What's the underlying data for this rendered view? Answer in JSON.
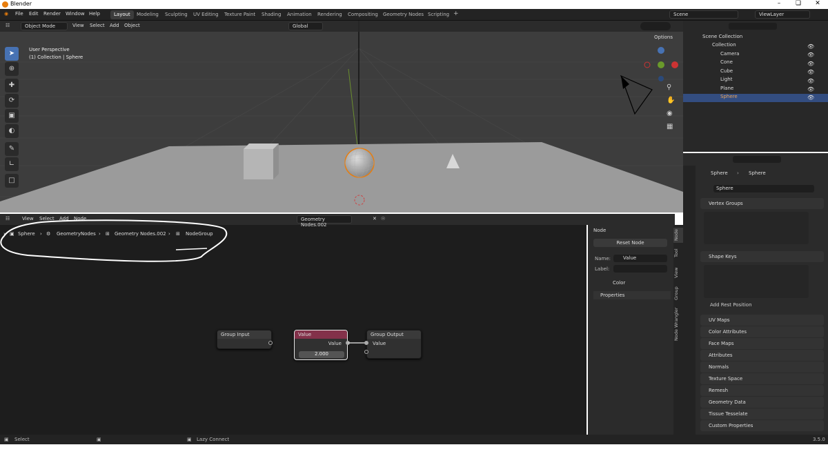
{
  "window": {
    "title": "Blender"
  },
  "menu": [
    "File",
    "Edit",
    "Render",
    "Window",
    "Help"
  ],
  "workspaces": [
    "Layout",
    "Modeling",
    "Sculpting",
    "UV Editing",
    "Texture Paint",
    "Shading",
    "Animation",
    "Rendering",
    "Compositing",
    "Geometry Nodes",
    "Scripting"
  ],
  "active_workspace": "Layout",
  "scene": "Scene",
  "view_layer": "ViewLayer",
  "viewport": {
    "mode": "Object Mode",
    "menus": [
      "View",
      "Select",
      "Add",
      "Object"
    ],
    "transform_orientation": "Global",
    "options_label": "Options",
    "overlay_line1": "User Perspective",
    "overlay_line2": "(1) Collection | Sphere"
  },
  "outliner": {
    "root": "Scene Collection",
    "collection": "Collection",
    "items": [
      "Camera",
      "Cone",
      "Cube",
      "Light",
      "Plane",
      "Sphere"
    ],
    "selected": "Sphere"
  },
  "node_editor": {
    "menus": [
      "View",
      "Select",
      "Add",
      "Node"
    ],
    "tree_name": "Geometry Nodes.002",
    "breadcrumbs": [
      "Sphere",
      "GeometryNodes",
      "Geometry Nodes.002",
      "NodeGroup"
    ],
    "nodes": {
      "group_input": {
        "title": "Group Input"
      },
      "value": {
        "title": "Value",
        "output": "Value",
        "field": "2.000"
      },
      "group_output": {
        "title": "Group Output",
        "input": "Value"
      }
    }
  },
  "npanel": {
    "section": "Node",
    "reset_button": "Reset Node",
    "name_label": "Name:",
    "name_value": "Value",
    "label_label": "Label:",
    "label_value": "",
    "color": "Color",
    "properties": "Properties",
    "tabs": [
      "Node",
      "Tool",
      "View",
      "Group",
      "Node Wrangler"
    ]
  },
  "properties": {
    "breadcrumb_object": "Sphere",
    "breadcrumb_data": "Sphere",
    "data_name": "Sphere",
    "vertex_groups": "Vertex Groups",
    "shape_keys": "Shape Keys",
    "add_rest_position": "Add Rest Position",
    "sections": [
      "UV Maps",
      "Color Attributes",
      "Face Maps",
      "Attributes",
      "Normals",
      "Texture Space",
      "Remesh",
      "Geometry Data",
      "Tissue Tesselate",
      "Custom Properties"
    ]
  },
  "status": {
    "select": "Select",
    "lazy_connect": "Lazy Connect",
    "version": "3.5.0"
  },
  "colors": {
    "accent": "#4772b3",
    "value_node_header": "#83314a",
    "selection_orange": "#e87d0d"
  }
}
